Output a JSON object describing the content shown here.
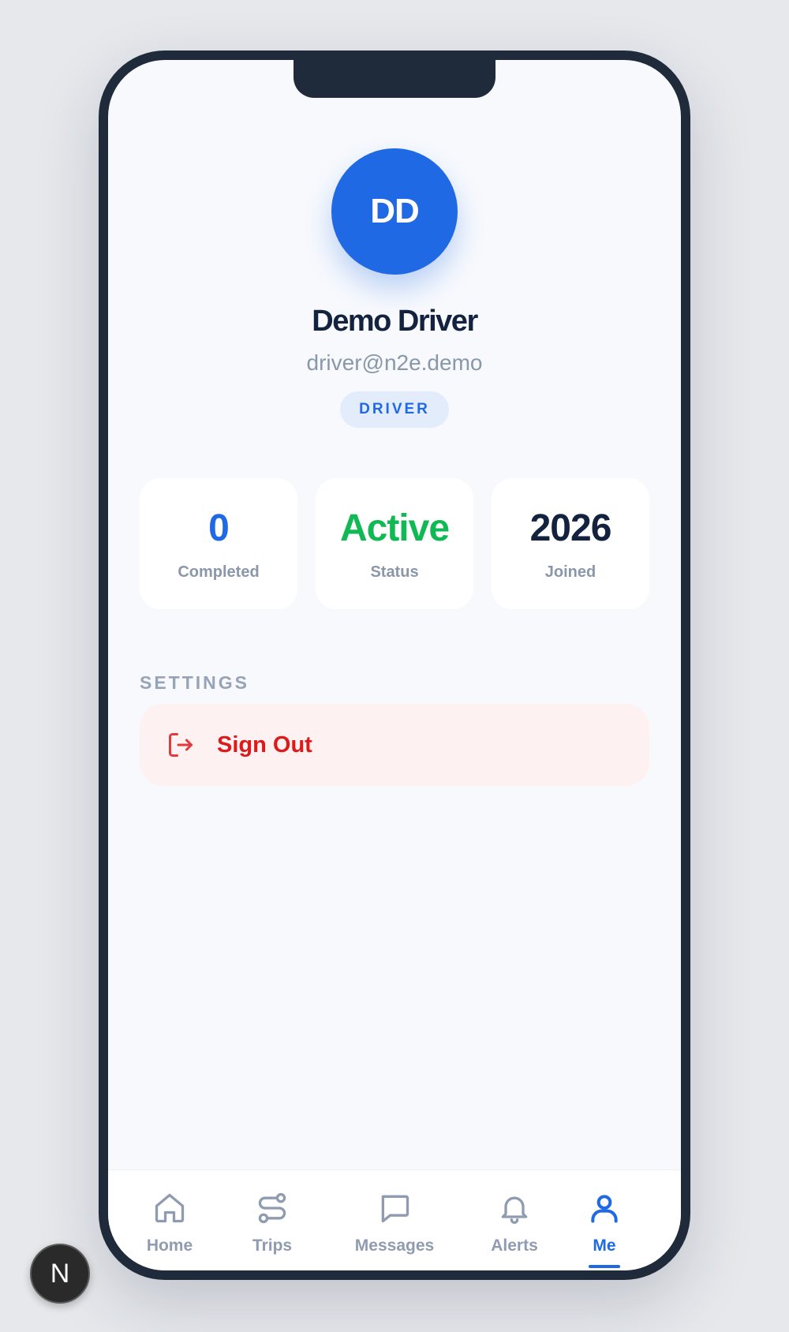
{
  "profile": {
    "initials": "DD",
    "name": "Demo Driver",
    "email": "driver@n2e.demo",
    "role": "DRIVER"
  },
  "stats": [
    {
      "value": "0",
      "label": "Completed",
      "color": "#1f6ae4"
    },
    {
      "value": "Active",
      "label": "Status",
      "color": "#10b954"
    },
    {
      "value": "2026",
      "label": "Joined",
      "color": "#13233f"
    }
  ],
  "settings": {
    "section_label": "SETTINGS",
    "sign_out_label": "Sign Out",
    "sign_out_icon": "logout-icon"
  },
  "tabbar": {
    "items": [
      {
        "label": "Home",
        "icon": "home-icon",
        "active": false
      },
      {
        "label": "Trips",
        "icon": "route-icon",
        "active": false
      },
      {
        "label": "Messages",
        "icon": "message-icon",
        "active": false
      },
      {
        "label": "Alerts",
        "icon": "bell-icon",
        "active": false
      },
      {
        "label": "Me",
        "icon": "user-icon",
        "active": true
      }
    ]
  },
  "overlay": {
    "badge_letter": "N"
  },
  "colors": {
    "accent": "#1f6ae4",
    "success": "#10b954",
    "danger": "#dc1a1a",
    "muted": "#8a97ab"
  }
}
